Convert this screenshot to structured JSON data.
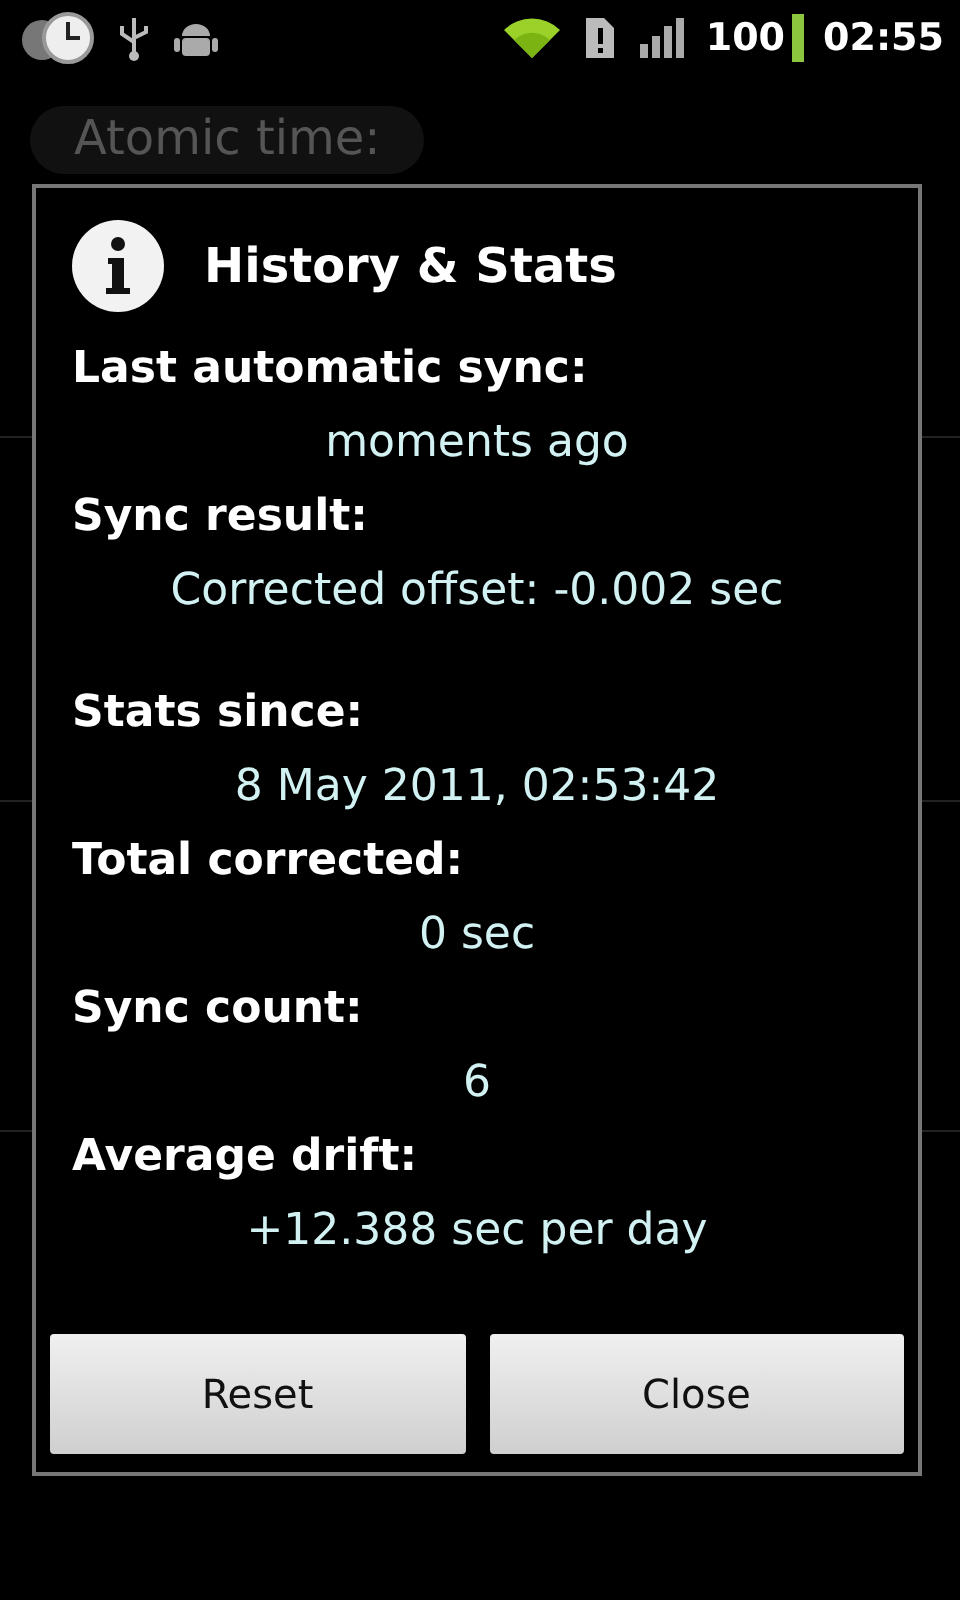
{
  "status_bar": {
    "battery": "100",
    "time": "02:55"
  },
  "background": {
    "atomic_label": "Atomic time:"
  },
  "dialog": {
    "title": "History & Stats",
    "items": [
      {
        "label": "Last automatic sync:",
        "value": "moments ago"
      },
      {
        "label": "Sync result:",
        "value": "Corrected offset: -0.002 sec"
      },
      {
        "label": "Stats since:",
        "value": "8 May 2011, 02:53:42"
      },
      {
        "label": "Total corrected:",
        "value": "0 sec"
      },
      {
        "label": "Sync count:",
        "value": "6"
      },
      {
        "label": "Average drift:",
        "value": "+12.388 sec per day"
      }
    ],
    "buttons": [
      "Reset",
      "Close"
    ]
  }
}
